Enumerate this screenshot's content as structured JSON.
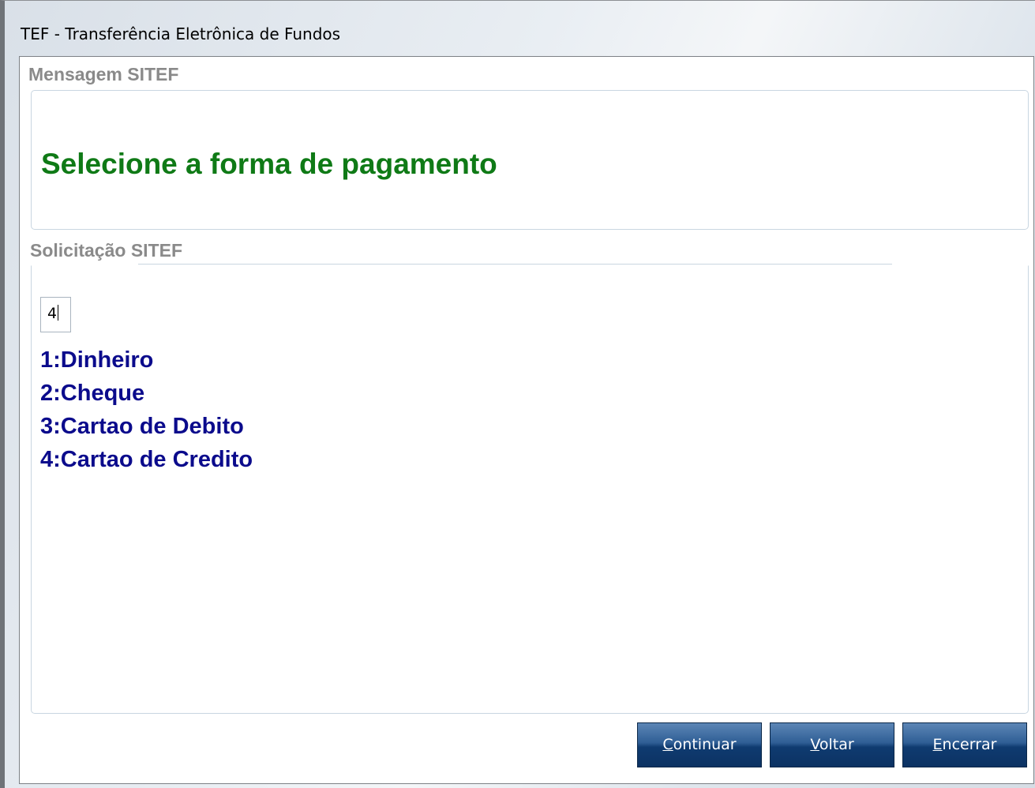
{
  "window": {
    "title": "TEF - Transferência Eletrônica de Fundos"
  },
  "message_group": {
    "label": "Mensagem SITEF",
    "text": "Selecione a forma de pagamento",
    "text_color": "#0f7a16"
  },
  "request_group": {
    "label": "Solicitação SITEF",
    "input_value": "4",
    "options": [
      "1:Dinheiro",
      "2:Cheque",
      "3:Cartao de Debito",
      "4:Cartao de Credito"
    ],
    "options_color": "#0b0b8c"
  },
  "buttons": {
    "continuar": {
      "hotkey": "C",
      "rest": "ontinuar"
    },
    "voltar": {
      "hotkey": "V",
      "rest": "oltar"
    },
    "encerrar": {
      "hotkey": "E",
      "rest": "ncerrar"
    }
  }
}
